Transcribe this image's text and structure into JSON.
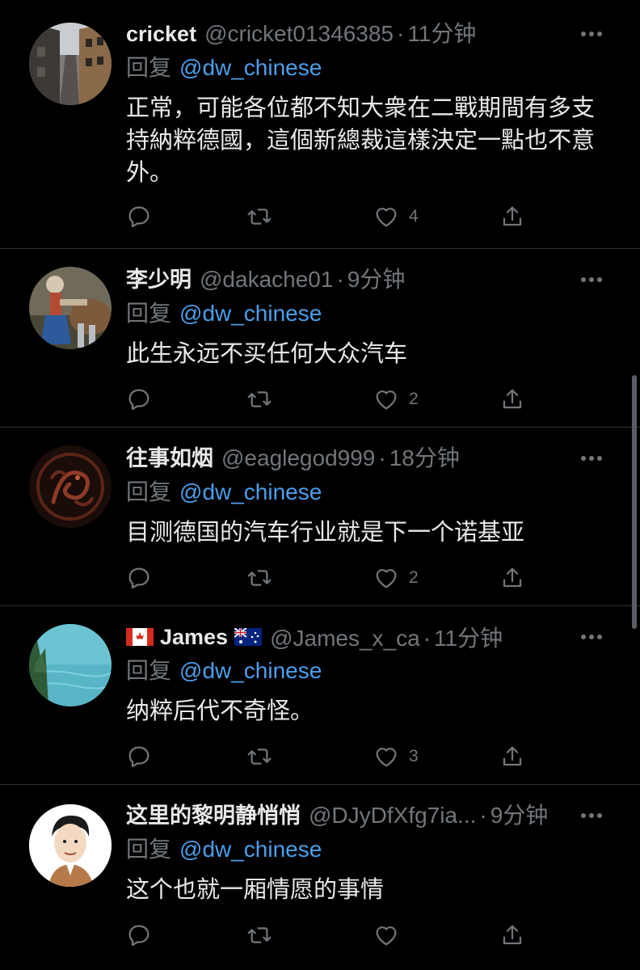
{
  "colors": {
    "background": "#000000",
    "text_primary": "#e7e9ea",
    "text_secondary": "#71767b",
    "accent": "#4c9eeb",
    "divider": "#2f3336"
  },
  "tweets": [
    {
      "display_name": "cricket",
      "handle": "@cricket01346385",
      "time": "11分钟",
      "reply_prefix": "回复",
      "reply_to": "@dw_chinese",
      "text": "正常，可能各位都不知大衆在二戰期間有多支持納粹德國，這個新總裁這樣決定一點也不意外。",
      "likes": "4",
      "avatar_icon": "street-photo-avatar"
    },
    {
      "display_name": "李少明",
      "handle": "@dakache01",
      "time": "9分钟",
      "reply_prefix": "回复",
      "reply_to": "@dw_chinese",
      "text": "此生永远不买任何大众汽车",
      "likes": "2",
      "avatar_icon": "painting-avatar"
    },
    {
      "display_name": "往事如烟",
      "handle": "@eaglegod999",
      "time": "18分钟",
      "reply_prefix": "回复",
      "reply_to": "@dw_chinese",
      "text": "目测德国的汽车行业就是下一个诺基亚",
      "likes": "2",
      "avatar_icon": "dragon-sigil-avatar"
    },
    {
      "display_name": "James",
      "flag_before": "canada-flag-icon",
      "flag_after": "australia-flag-icon",
      "handle": "@James_x_ca",
      "time": "11分钟",
      "reply_prefix": "回复",
      "reply_to": "@dw_chinese",
      "text": "纳粹后代不奇怪。",
      "likes": "3",
      "avatar_icon": "lake-avatar"
    },
    {
      "display_name": "这里的黎明静悄悄",
      "handle": "@DJyDfXfg7ia...",
      "time": "9分钟",
      "reply_prefix": "回复",
      "reply_to": "@dw_chinese",
      "text": "这个也就一厢情愿的事情",
      "likes": "",
      "avatar_icon": "cartoon-man-avatar"
    }
  ]
}
